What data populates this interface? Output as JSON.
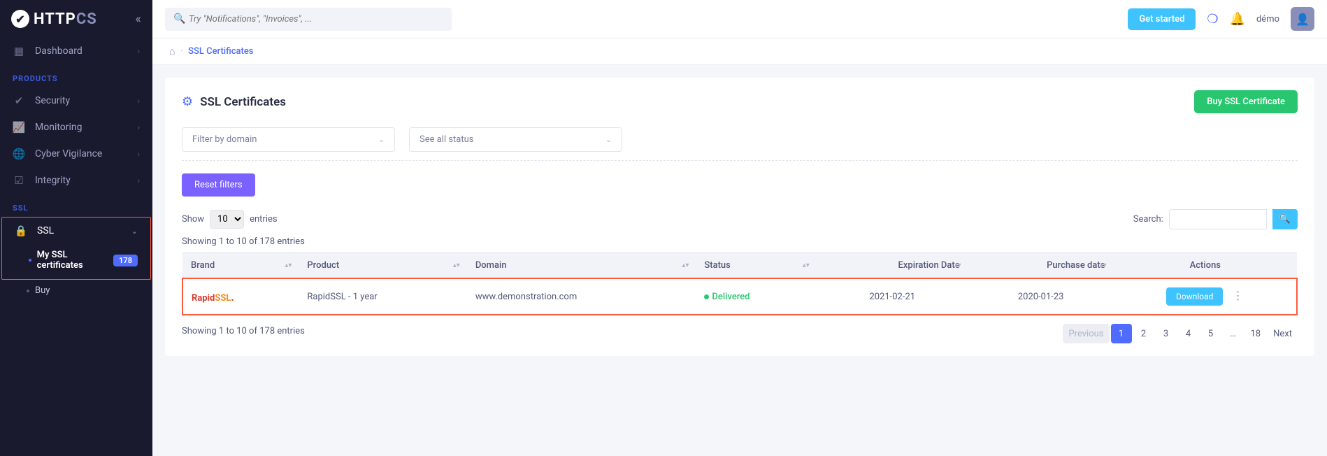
{
  "logo": {
    "text_a": "HTTP",
    "text_b": "CS"
  },
  "sidebar": {
    "dashboard": "Dashboard",
    "section_products": "PRODUCTS",
    "items": [
      {
        "label": "Security"
      },
      {
        "label": "Monitoring"
      },
      {
        "label": "Cyber Vigilance"
      },
      {
        "label": "Integrity"
      }
    ],
    "section_ssl": "SSL",
    "ssl_label": "SSL",
    "sub": {
      "my_certs": "My SSL certificates",
      "my_certs_badge": "178",
      "buy": "Buy"
    }
  },
  "topbar": {
    "search_placeholder": "Try \"Notifications\", \"Invoices\", ...",
    "get_started": "Get started",
    "user": "démo"
  },
  "breadcrumb": {
    "current": "SSL Certificates"
  },
  "page": {
    "title": "SSL Certificates",
    "buy_button": "Buy SSL Certificate",
    "filter_domain": "Filter by domain",
    "filter_status": "See all status",
    "reset_filters": "Reset filters",
    "show_label": "Show",
    "entries_label": "entries",
    "show_value": "10",
    "search_label": "Search:",
    "info_top": "Showing 1 to 10 of 178 entries",
    "info_bottom": "Showing 1 to 10 of 178 entries"
  },
  "table": {
    "headers": {
      "brand": "Brand",
      "product": "Product",
      "domain": "Domain",
      "status": "Status",
      "expiration": "Expiration Date",
      "purchase": "Purchase date",
      "actions": "Actions"
    },
    "row": {
      "brand_a": "Rapid",
      "brand_b": "SSL",
      "product": "RapidSSL - 1 year",
      "domain": "www.demonstration.com",
      "status": "Delivered",
      "expiration": "2021-02-21",
      "purchase": "2020-01-23",
      "download": "Download"
    }
  },
  "pagination": {
    "prev": "Previous",
    "pages": [
      "1",
      "2",
      "3",
      "4",
      "5",
      "…",
      "18"
    ],
    "next": "Next"
  }
}
